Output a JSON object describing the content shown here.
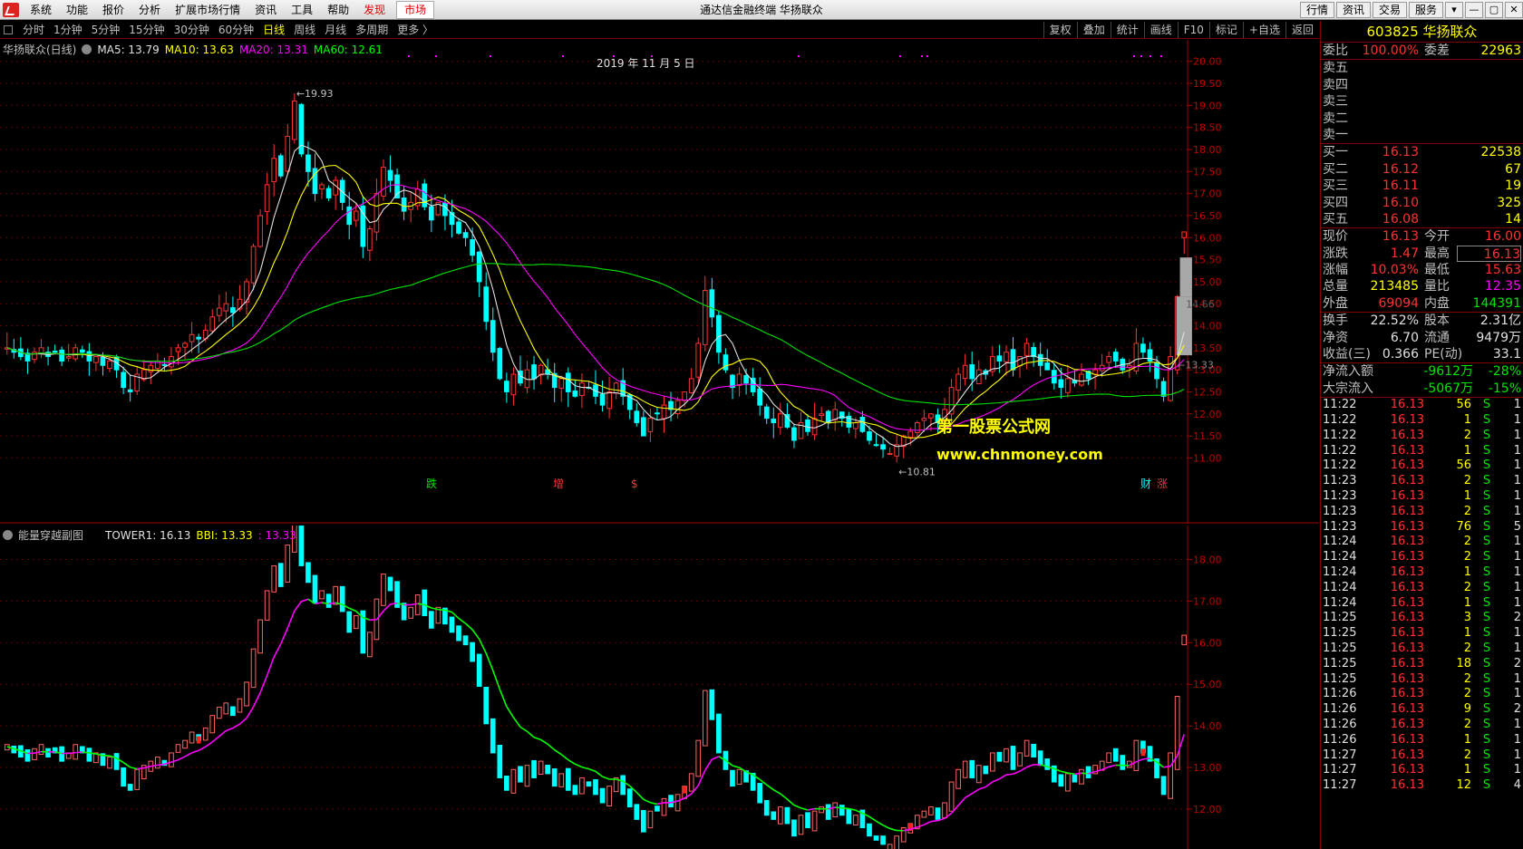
{
  "menubar": {
    "items": [
      "系统",
      "功能",
      "报价",
      "分析",
      "扩展市场行情",
      "资讯",
      "工具",
      "帮助"
    ],
    "hot_item": "发现",
    "boxed_item": "市场",
    "title": "通达信金融终端 华扬联众",
    "right_buttons": [
      "行情",
      "资讯",
      "交易",
      "服务"
    ],
    "window_buttons": [
      "▾",
      "—",
      "▢",
      "✕"
    ]
  },
  "toolbar": {
    "periods": [
      "分时",
      "1分钟",
      "5分钟",
      "15分钟",
      "30分钟",
      "60分钟",
      "日线",
      "周线",
      "月线",
      "多周期",
      "更多 〉"
    ],
    "active_period": "日线",
    "tools": [
      "复权",
      "叠加",
      "统计",
      "画线",
      "F10",
      "标记",
      "+自选",
      "返回"
    ]
  },
  "main_chart": {
    "stock_name": "华扬联众(日线)",
    "ma": [
      {
        "label": "MA5: 13.79",
        "color": "#e0e0e0"
      },
      {
        "label": "MA10: 13.63",
        "color": "#ffff00"
      },
      {
        "label": "MA20: 13.31",
        "color": "#ff00ff"
      },
      {
        "label": "MA60: 12.61",
        "color": "#00ff00"
      }
    ],
    "date_label": "2019 年 11 月 5 日",
    "high_label": "19.93",
    "low_label": "10.81",
    "last_box_label": "14.66",
    "last_line_label": "13.33",
    "events": [
      "跌",
      "增",
      "$",
      "财",
      "涨"
    ]
  },
  "sub_chart": {
    "name": "能量穿越副图",
    "tower_label": "TOWER1: 16.13",
    "bbi_label": "BBI: 13.33",
    "bbi2_label": ": 13.33"
  },
  "watermark": {
    "line1": "第一股票公式网",
    "line2": "www.chnmoney.com"
  },
  "chart_data": [
    {
      "type": "candlestick",
      "title": "华扬联众(日线)",
      "y_ticks": [
        "20.00",
        "19.50",
        "19.00",
        "18.50",
        "18.00",
        "17.50",
        "17.00",
        "16.50",
        "16.00",
        "15.50",
        "15.00",
        "14.50",
        "14.00",
        "13.50",
        "13.00",
        "12.50",
        "12.00",
        "11.50",
        "11.00"
      ],
      "ylim": [
        10.7,
        20.2
      ],
      "closes": [
        13.5,
        13.4,
        13.3,
        13.2,
        13.4,
        13.5,
        13.3,
        13.4,
        13.2,
        13.3,
        13.5,
        13.4,
        13.2,
        13.3,
        13.1,
        13.2,
        13.0,
        12.6,
        12.5,
        12.9,
        13.0,
        13.1,
        13.2,
        13.1,
        13.3,
        13.5,
        13.6,
        13.8,
        13.7,
        13.9,
        14.2,
        14.4,
        14.5,
        14.3,
        14.6,
        15.0,
        15.8,
        16.5,
        17.2,
        17.8,
        17.4,
        18.3,
        19.1,
        17.9,
        17.5,
        17.0,
        17.2,
        16.9,
        17.3,
        16.8,
        16.3,
        16.6,
        15.8,
        16.2,
        17.0,
        17.6,
        17.3,
        16.9,
        16.6,
        16.8,
        17.1,
        16.7,
        16.4,
        16.8,
        16.5,
        16.3,
        16.1,
        16.0,
        15.6,
        15.0,
        14.1,
        13.4,
        12.8,
        12.5,
        12.9,
        12.7,
        13.0,
        12.8,
        13.1,
        12.9,
        12.6,
        12.8,
        12.5,
        12.4,
        12.7,
        12.6,
        12.4,
        12.2,
        12.5,
        12.7,
        12.4,
        12.1,
        11.8,
        11.5,
        11.9,
        12.0,
        12.2,
        12.1,
        12.3,
        12.5,
        12.8,
        13.6,
        14.8,
        14.2,
        13.4,
        13.0,
        12.6,
        12.9,
        12.7,
        12.5,
        12.2,
        11.9,
        11.8,
        12.0,
        11.7,
        11.4,
        11.8,
        11.6,
        11.9,
        12.0,
        11.8,
        12.1,
        11.9,
        11.7,
        11.8,
        11.6,
        11.4,
        11.3,
        11.2,
        11.1,
        11.3,
        11.5,
        11.6,
        11.8,
        11.9,
        12.0,
        11.8,
        12.1,
        12.6,
        12.9,
        13.1,
        12.8,
        13.0,
        12.9,
        13.3,
        13.2,
        13.4,
        13.0,
        13.3,
        13.6,
        13.3,
        13.1,
        13.0,
        12.7,
        12.6,
        12.8,
        12.7,
        12.9,
        12.8,
        13.0,
        13.1,
        13.3,
        13.2,
        13.0,
        13.1,
        13.6,
        13.4,
        13.2,
        12.8,
        12.4,
        13.3,
        14.66,
        16.13
      ],
      "ma_series": [
        "MA5",
        "MA10",
        "MA20",
        "MA60"
      ]
    },
    {
      "type": "bar",
      "title": "能量穿越副图",
      "y_ticks": [
        "18.00",
        "17.00",
        "16.00",
        "15.00",
        "14.00",
        "13.00",
        "12.00"
      ],
      "ylim": [
        11.3,
        18.6
      ],
      "series": [
        {
          "name": "TOWER1"
        },
        {
          "name": "BBI"
        }
      ]
    }
  ],
  "quote": {
    "code_name": "603825 华扬联众",
    "weibi": {
      "l1": "委比",
      "v1": "100.00%",
      "l2": "委差",
      "v2": "22963"
    },
    "asks": [
      {
        "label": "卖五",
        "price": "",
        "vol": ""
      },
      {
        "label": "卖四",
        "price": "",
        "vol": ""
      },
      {
        "label": "卖三",
        "price": "",
        "vol": ""
      },
      {
        "label": "卖二",
        "price": "",
        "vol": ""
      },
      {
        "label": "卖一",
        "price": "",
        "vol": ""
      }
    ],
    "bids": [
      {
        "label": "买一",
        "price": "16.13",
        "vol": "22538"
      },
      {
        "label": "买二",
        "price": "16.12",
        "vol": "67"
      },
      {
        "label": "买三",
        "price": "16.11",
        "vol": "19"
      },
      {
        "label": "买四",
        "price": "16.10",
        "vol": "325"
      },
      {
        "label": "买五",
        "price": "16.08",
        "vol": "14"
      }
    ],
    "stats1": [
      {
        "l1": "现价",
        "v1": "16.13",
        "c1": "red",
        "l2": "今开",
        "v2": "16.00",
        "c2": "red"
      },
      {
        "l1": "涨跌",
        "v1": "1.47",
        "c1": "red",
        "l2": "最高",
        "v2": "16.13",
        "c2": "red"
      },
      {
        "l1": "涨幅",
        "v1": "10.03%",
        "c1": "red",
        "l2": "最低",
        "v2": "15.63",
        "c2": "red"
      },
      {
        "l1": "总量",
        "v1": "213485",
        "c1": "yel",
        "l2": "量比",
        "v2": "12.35",
        "c2": "mag"
      },
      {
        "l1": "外盘",
        "v1": "69094",
        "c1": "red",
        "l2": "内盘",
        "v2": "144391",
        "c2": "grn"
      }
    ],
    "stats2": [
      {
        "l1": "换手",
        "v1": "22.52%",
        "c1": "wht",
        "l2": "股本",
        "v2": "2.31亿",
        "c2": "wht"
      },
      {
        "l1": "净资",
        "v1": "6.70",
        "c1": "wht",
        "l2": "流通",
        "v2": "9479万",
        "c2": "wht"
      },
      {
        "l1": "收益(三)",
        "v1": "0.366",
        "c1": "wht",
        "l2": "PE(动)",
        "v2": "33.1",
        "c2": "wht"
      }
    ],
    "flows": [
      {
        "label": "净流入额",
        "amount": "-9612万",
        "pct": "-28%"
      },
      {
        "label": "大宗流入",
        "amount": "-5067万",
        "pct": "-15%"
      }
    ],
    "ticks": [
      {
        "t": "11:22",
        "p": "16.13",
        "v": "56",
        "d": "S",
        "n": "1"
      },
      {
        "t": "11:22",
        "p": "16.13",
        "v": "1",
        "d": "S",
        "n": "1"
      },
      {
        "t": "11:22",
        "p": "16.13",
        "v": "2",
        "d": "S",
        "n": "1"
      },
      {
        "t": "11:22",
        "p": "16.13",
        "v": "1",
        "d": "S",
        "n": "1"
      },
      {
        "t": "11:22",
        "p": "16.13",
        "v": "56",
        "d": "S",
        "n": "1"
      },
      {
        "t": "11:23",
        "p": "16.13",
        "v": "2",
        "d": "S",
        "n": "1"
      },
      {
        "t": "11:23",
        "p": "16.13",
        "v": "1",
        "d": "S",
        "n": "1"
      },
      {
        "t": "11:23",
        "p": "16.13",
        "v": "2",
        "d": "S",
        "n": "1"
      },
      {
        "t": "11:23",
        "p": "16.13",
        "v": "76",
        "d": "S",
        "n": "5"
      },
      {
        "t": "11:24",
        "p": "16.13",
        "v": "2",
        "d": "S",
        "n": "1"
      },
      {
        "t": "11:24",
        "p": "16.13",
        "v": "2",
        "d": "S",
        "n": "1"
      },
      {
        "t": "11:24",
        "p": "16.13",
        "v": "1",
        "d": "S",
        "n": "1"
      },
      {
        "t": "11:24",
        "p": "16.13",
        "v": "2",
        "d": "S",
        "n": "1"
      },
      {
        "t": "11:24",
        "p": "16.13",
        "v": "1",
        "d": "S",
        "n": "1"
      },
      {
        "t": "11:25",
        "p": "16.13",
        "v": "3",
        "d": "S",
        "n": "2"
      },
      {
        "t": "11:25",
        "p": "16.13",
        "v": "1",
        "d": "S",
        "n": "1"
      },
      {
        "t": "11:25",
        "p": "16.13",
        "v": "2",
        "d": "S",
        "n": "1"
      },
      {
        "t": "11:25",
        "p": "16.13",
        "v": "18",
        "d": "S",
        "n": "2"
      },
      {
        "t": "11:25",
        "p": "16.13",
        "v": "2",
        "d": "S",
        "n": "1"
      },
      {
        "t": "11:26",
        "p": "16.13",
        "v": "2",
        "d": "S",
        "n": "1"
      },
      {
        "t": "11:26",
        "p": "16.13",
        "v": "9",
        "d": "S",
        "n": "2"
      },
      {
        "t": "11:26",
        "p": "16.13",
        "v": "2",
        "d": "S",
        "n": "1"
      },
      {
        "t": "11:26",
        "p": "16.13",
        "v": "1",
        "d": "S",
        "n": "1"
      },
      {
        "t": "11:27",
        "p": "16.13",
        "v": "2",
        "d": "S",
        "n": "1"
      },
      {
        "t": "11:27",
        "p": "16.13",
        "v": "1",
        "d": "S",
        "n": "1"
      },
      {
        "t": "11:27",
        "p": "16.13",
        "v": "12",
        "d": "S",
        "n": "4"
      }
    ]
  }
}
